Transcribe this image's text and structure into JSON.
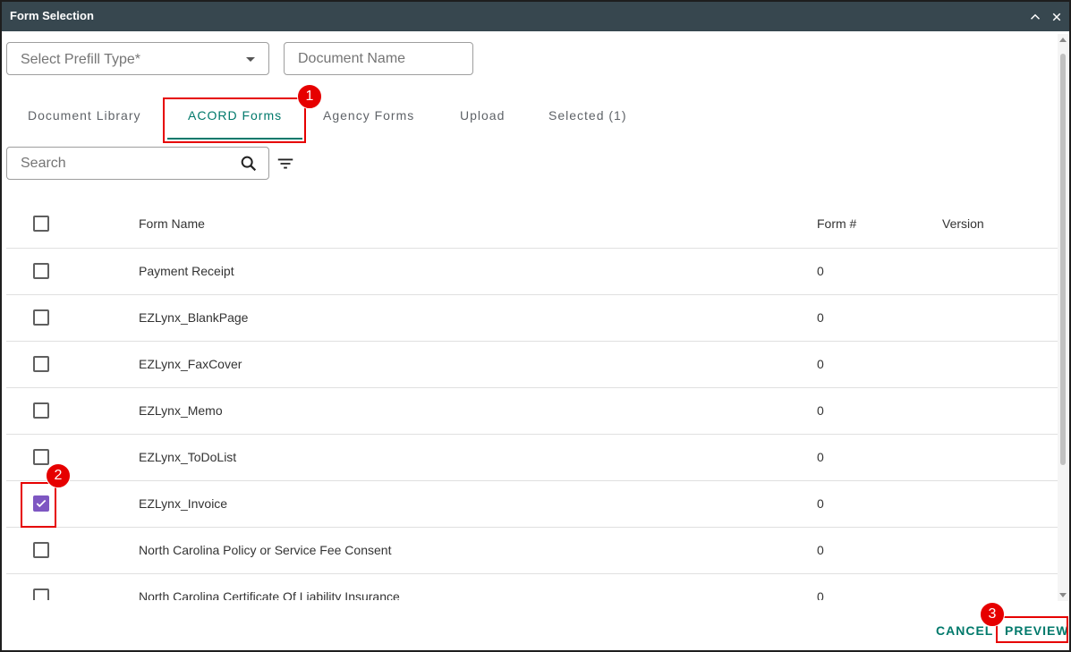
{
  "window": {
    "title": "Form Selection"
  },
  "filters": {
    "prefill_placeholder": "Select Prefill Type*",
    "document_name_placeholder": "Document Name"
  },
  "tabs": [
    {
      "label": "Document Library",
      "active": false
    },
    {
      "label": "ACORD Forms",
      "active": true
    },
    {
      "label": "Agency Forms",
      "active": false
    },
    {
      "label": "Upload",
      "active": false
    },
    {
      "label": "Selected (1)",
      "active": false
    }
  ],
  "search": {
    "placeholder": "Search"
  },
  "table": {
    "headers": {
      "name": "Form Name",
      "number": "Form #",
      "version": "Version"
    },
    "rows": [
      {
        "name": "Payment Receipt",
        "number": "0",
        "checked": false
      },
      {
        "name": "EZLynx_BlankPage",
        "number": "0",
        "checked": false
      },
      {
        "name": "EZLynx_FaxCover",
        "number": "0",
        "checked": false
      },
      {
        "name": "EZLynx_Memo",
        "number": "0",
        "checked": false
      },
      {
        "name": "EZLynx_ToDoList",
        "number": "0",
        "checked": false
      },
      {
        "name": "EZLynx_Invoice",
        "number": "0",
        "checked": true
      },
      {
        "name": "North Carolina Policy or Service Fee Consent",
        "number": "0",
        "checked": false
      },
      {
        "name": "North Carolina Certificate Of Liability Insurance",
        "number": "0",
        "checked": false
      }
    ]
  },
  "actions": {
    "cancel": "CANCEL",
    "preview": "PREVIEW"
  },
  "annotations": {
    "badge1": "1",
    "badge2": "2",
    "badge3": "3"
  },
  "colors": {
    "titlebar": "#37474f",
    "accent": "#00796b",
    "checkbox_checked": "#7e57c2",
    "annotation": "#e60000"
  }
}
